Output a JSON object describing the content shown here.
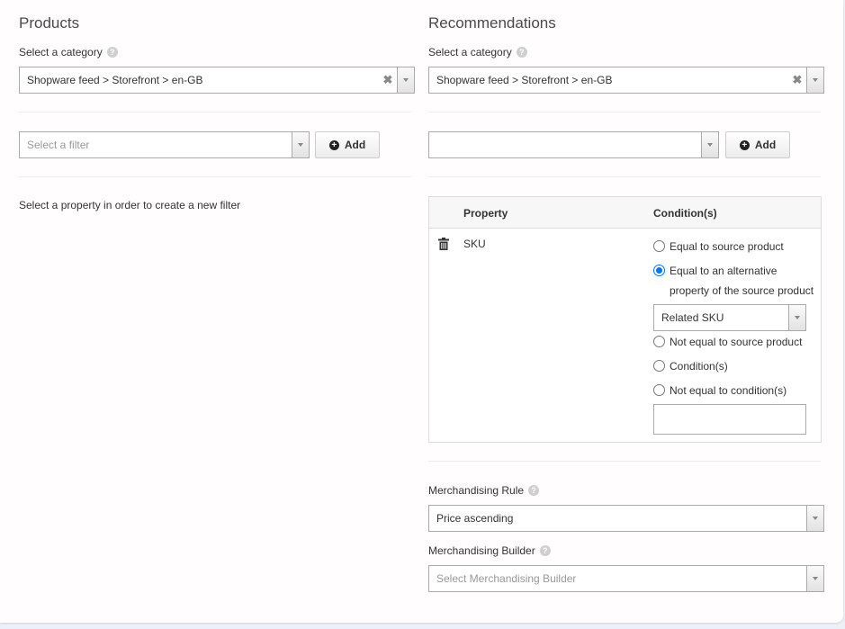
{
  "products": {
    "title": "Products",
    "category_label": "Select a category",
    "category_value": "Shopware feed > Storefront > en-GB",
    "filter_placeholder": "Select a filter",
    "add_label": "Add",
    "info_text": "Select a property in order to create a new filter"
  },
  "recommendations": {
    "title": "Recommendations",
    "category_label": "Select a category",
    "category_value": "Shopware feed > Storefront > en-GB",
    "filter_value": "",
    "add_label": "Add",
    "table": {
      "headers": [
        "Property",
        "Condition(s)"
      ],
      "rows": [
        {
          "property": "SKU",
          "conditions": [
            {
              "label": "Equal to source product",
              "checked": false
            },
            {
              "label": "Equal to an alternative",
              "label_line2": "property of the source product",
              "checked": true
            },
            {
              "label": "Not equal to source product",
              "checked": false
            },
            {
              "label": "Condition(s)",
              "checked": false
            },
            {
              "label": "Not equal to condition(s)",
              "checked": false
            }
          ],
          "alternative_property": "Related SKU",
          "condition_input": ""
        }
      ]
    },
    "merch_rule_label": "Merchandising Rule",
    "merch_rule_value": "Price ascending",
    "merch_builder_label": "Merchandising Builder",
    "merch_builder_placeholder": "Select Merchandising Builder"
  },
  "icons": {
    "help": "?",
    "clear": "✖",
    "plus": "+",
    "trash": "trash-icon"
  }
}
